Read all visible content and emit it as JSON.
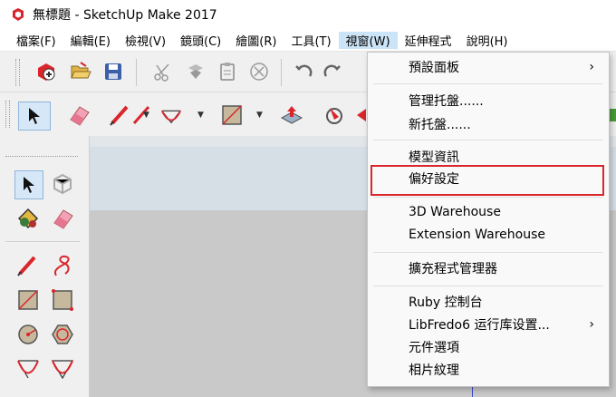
{
  "window": {
    "title": "無標題 - SketchUp Make 2017"
  },
  "menubar": {
    "items": [
      "檔案(F)",
      "編輯(E)",
      "檢視(V)",
      "鏡頭(C)",
      "繪圖(R)",
      "工具(T)",
      "視窗(W)",
      "延伸程式",
      "說明(H)"
    ],
    "active": "視窗(W)"
  },
  "window_menu": {
    "items": [
      {
        "label": "預設面板",
        "submenu": "›"
      },
      {
        "label": "管理托盤......"
      },
      {
        "label": "新托盤......"
      },
      {
        "label": "模型資訊"
      },
      {
        "label": "偏好設定",
        "highlighted": true
      },
      {
        "label": "3D Warehouse"
      },
      {
        "label": "Extension Warehouse"
      },
      {
        "label": "擴充程式管理器"
      },
      {
        "label": "Ruby 控制台"
      },
      {
        "label": "LibFredo6 运行库设置...",
        "submenu": "›"
      },
      {
        "label": "元件選項"
      },
      {
        "label": "相片紋理"
      }
    ],
    "highlight_color": "#d9262c"
  },
  "colors": {
    "menu_active": "#cce4f7",
    "axis_blue": "#3a49c9",
    "sky": "#d6dfe6",
    "ground": "#c9c9c9"
  }
}
